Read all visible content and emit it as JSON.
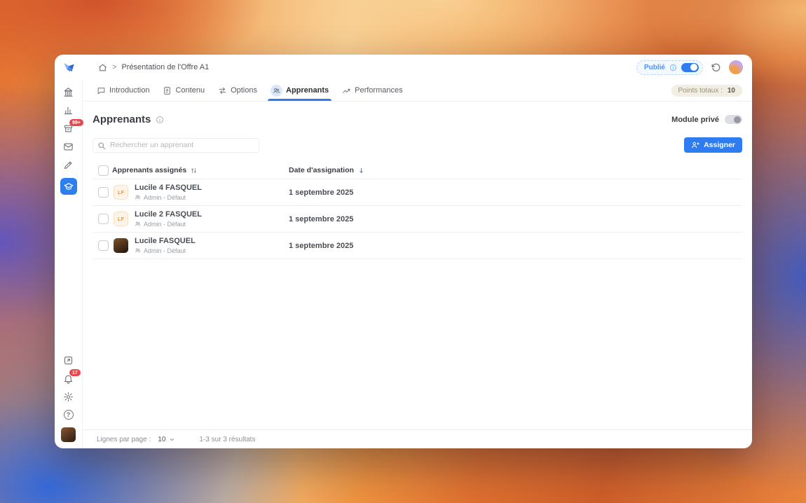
{
  "window": {
    "breadcrumb": {
      "separator": ">",
      "page": "Présentation de l'Offre A1"
    },
    "topbar": {
      "publish_label": "Publié"
    },
    "tabs": {
      "items": [
        {
          "label": "Introduction"
        },
        {
          "label": "Contenu"
        },
        {
          "label": "Options"
        },
        {
          "label": "Apprenants"
        },
        {
          "label": "Performances"
        }
      ],
      "points_badge": {
        "label": "Points totaux :",
        "value": "10"
      }
    },
    "content": {
      "title": "Apprenants",
      "module_private_label": "Module privé",
      "search": {
        "placeholder": "Rechercher un apprenant"
      },
      "assign_button_label": "Assigner",
      "table": {
        "columns": {
          "learners": "Apprenants assignés",
          "date": "Date d'assignation"
        },
        "rows": [
          {
            "name": "Lucile 4 FASQUEL",
            "role": "Admin - Défaut",
            "date": "1 septembre 2025",
            "initials": "LF"
          },
          {
            "name": "Lucile 2 FASQUEL",
            "role": "Admin - Défaut",
            "date": "1 septembre 2025",
            "initials": "LF"
          },
          {
            "name": "Lucile FASQUEL",
            "role": "Admin - Défaut",
            "date": "1 septembre 2025",
            "initials": ""
          }
        ]
      },
      "footer": {
        "rows_per_page_label": "Lignes par page :",
        "rows_per_page_value": "10",
        "results": "1-3 sur 3 résultats"
      }
    },
    "sidebar": {
      "badge_inbox": "99+",
      "badge_bell": "17",
      "help_glyph": "?"
    }
  },
  "colors": {
    "accent_blue": "#2e7cf0",
    "badge_red": "#e5484d",
    "points_badge_bg": "#f3eee4",
    "publish_pill_border": "#b9d6f9"
  }
}
